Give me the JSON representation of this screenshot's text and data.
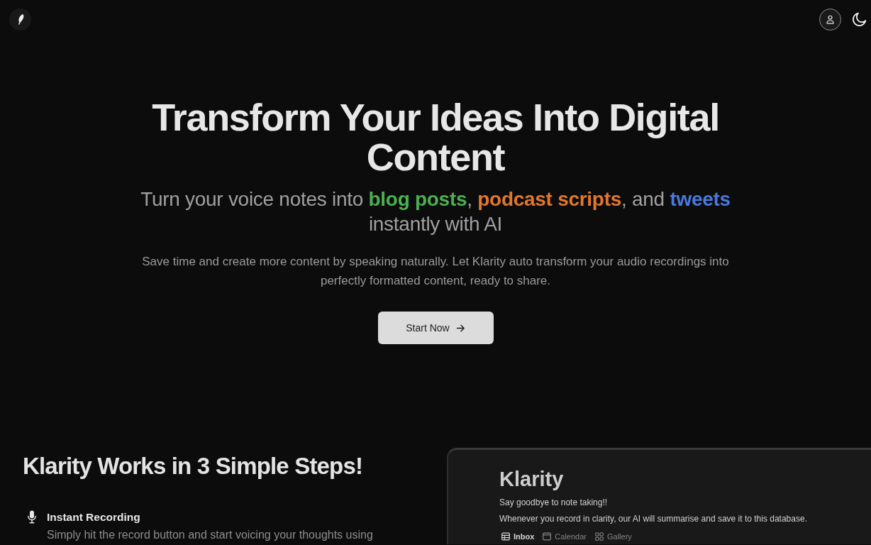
{
  "hero": {
    "title": "Transform Your Ideas Into Digital Content",
    "subtitle": [
      {
        "text": "Turn your voice notes into "
      },
      {
        "text": "blog posts",
        "color": "#4caf50"
      },
      {
        "text": ", "
      },
      {
        "text": "podcast scripts",
        "color": "#e2772c"
      },
      {
        "text": ", and "
      },
      {
        "text": "tweets",
        "color": "#4a78dc"
      },
      {
        "text": " instantly with AI"
      }
    ],
    "description": "Save time and create more content by speaking naturally. Let Klarity auto transform your audio recordings into perfectly formatted content, ready to share.",
    "cta_button": "Start Now"
  },
  "steps_section": {
    "heading": "Klarity Works in 3 Simple Steps!",
    "steps": [
      {
        "title": "Instant Recording",
        "description": "Simply hit the record button and start voicing your thoughts using"
      }
    ]
  },
  "app_preview": {
    "title": "Klarity",
    "lines": [
      "Say goodbye to note taking!!",
      "Whenever you record in clarity, our AI will summarise and save it to this database."
    ],
    "views": [
      {
        "label": "Inbox",
        "kind": "table",
        "selected": true
      },
      {
        "label": "Calendar",
        "kind": "calendar",
        "selected": false
      },
      {
        "label": "Gallery",
        "kind": "gallery",
        "selected": false
      }
    ]
  }
}
